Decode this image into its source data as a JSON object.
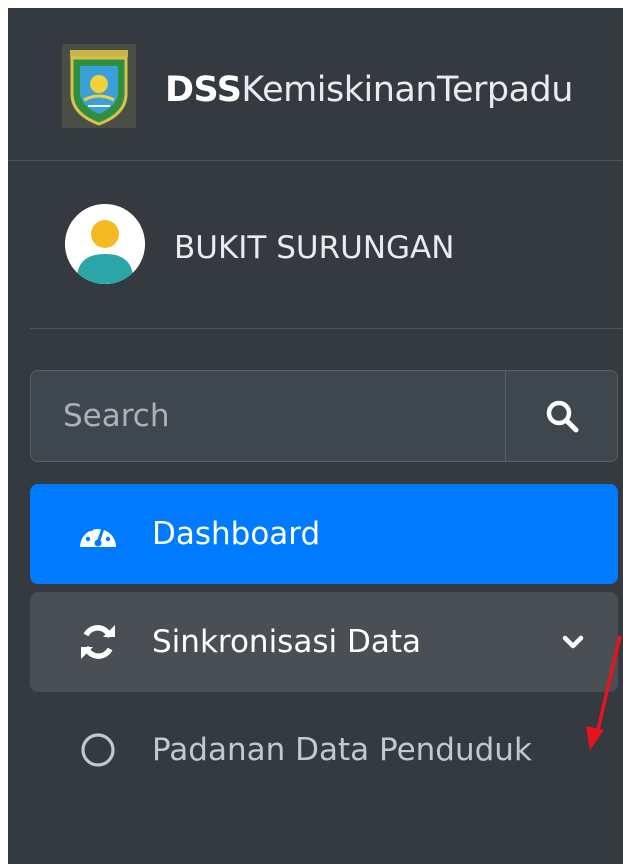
{
  "brand": {
    "title_bold": "DSS",
    "title_rest": "KemiskinanTerpadu",
    "logo_icon": "regency-crest-logo"
  },
  "user": {
    "name": "BUKIT SURUNGAN",
    "avatar_icon": "user-avatar-icon"
  },
  "search": {
    "placeholder": "Search",
    "button_icon": "search-icon"
  },
  "nav": {
    "dashboard": {
      "label": "Dashboard",
      "icon": "tachometer-icon",
      "active": true
    },
    "sync": {
      "label": "Sinkronisasi Data",
      "icon": "sync-icon",
      "expanded": true
    },
    "sub_items": [
      {
        "label": "Padanan Data Penduduk",
        "icon": "circle-outline-icon"
      }
    ]
  },
  "colors": {
    "sidebar_bg": "#343a40",
    "active_bg": "#007bff",
    "annotation_arrow": "#e8141c"
  }
}
